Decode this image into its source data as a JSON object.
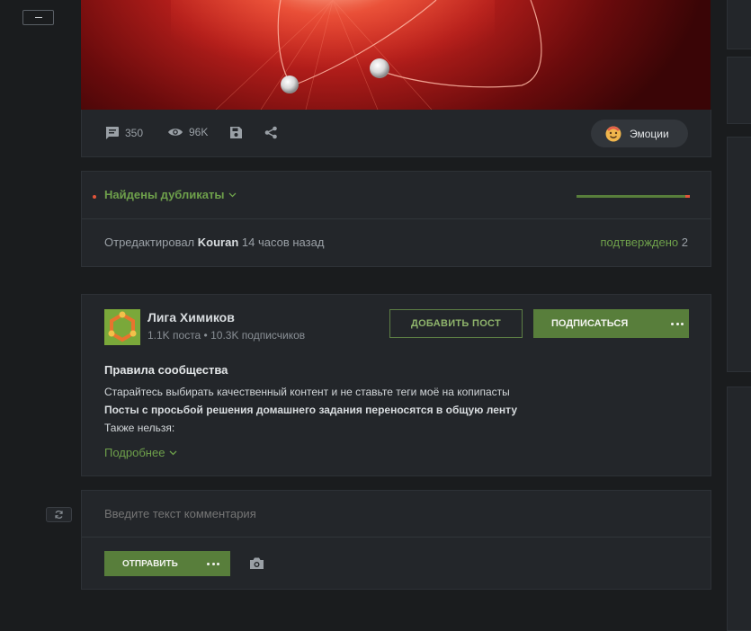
{
  "post": {
    "stats": {
      "comments": "350",
      "views": "96K"
    },
    "emotions_label": "Эмоции"
  },
  "duplicates": {
    "title": "Найдены дубликаты",
    "edited_prefix": "Отредактировал",
    "editor": "Kouran",
    "edited_time": "14 часов назад",
    "confirmed_label": "подтверждено",
    "confirmed_count": "2"
  },
  "community": {
    "name": "Лига Химиков",
    "stats": "1.1K поста • 10.3K подписчиков",
    "add_post_label": "ДОБАВИТЬ ПОСТ",
    "subscribe_label": "ПОДПИСАТЬСЯ",
    "rules_title": "Правила сообщества",
    "rules": {
      "line1": "Старайтесь выбирать качественный контент и не ставьте теги моё на копипасты",
      "line2": "Посты с просьбой решения домашнего задания переносятся в общую ленту",
      "line3": "Также нельзя:"
    },
    "more_label": "Подробнее"
  },
  "comment": {
    "placeholder": "Введите текст комментария",
    "send_label": "ОТПРАВИТЬ"
  },
  "colors": {
    "accent_green": "#6ea04b",
    "button_green": "#587e3b",
    "dot_red": "#e2543a"
  }
}
